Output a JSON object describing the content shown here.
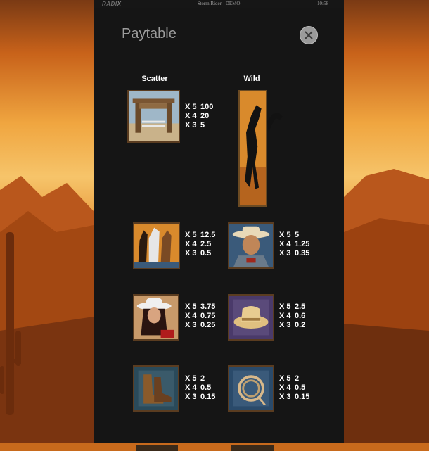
{
  "topbar": {
    "logo": "RADI",
    "title": "Storm Rider - DEMO",
    "time": "10:58"
  },
  "panel": {
    "title": "Paytable"
  },
  "headings": {
    "scatter": "Scatter",
    "wild": "Wild"
  },
  "symbols": [
    {
      "id": "scatter-gate",
      "icon": "ranch-gate-icon",
      "pays": [
        {
          "m": "X 5",
          "v": "100"
        },
        {
          "m": "X 4",
          "v": "20"
        },
        {
          "m": "X 3",
          "v": "5"
        }
      ]
    },
    {
      "id": "wild-horse",
      "icon": "black-stallion-icon",
      "pays": []
    },
    {
      "id": "horses",
      "icon": "horses-icon",
      "pays": [
        {
          "m": "X 5",
          "v": "12.5"
        },
        {
          "m": "X 4",
          "v": "2.5"
        },
        {
          "m": "X 3",
          "v": "0.5"
        }
      ]
    },
    {
      "id": "cowboy",
      "icon": "cowboy-icon",
      "pays": [
        {
          "m": "X 5",
          "v": "5"
        },
        {
          "m": "X 4",
          "v": "1.25"
        },
        {
          "m": "X 3",
          "v": "0.35"
        }
      ]
    },
    {
      "id": "cowgirl",
      "icon": "cowgirl-icon",
      "pays": [
        {
          "m": "X 5",
          "v": "3.75"
        },
        {
          "m": "X 4",
          "v": "0.75"
        },
        {
          "m": "X 3",
          "v": "0.25"
        }
      ]
    },
    {
      "id": "hat",
      "icon": "cowboy-hat-icon",
      "pays": [
        {
          "m": "X 5",
          "v": "2.5"
        },
        {
          "m": "X 4",
          "v": "0.6"
        },
        {
          "m": "X 3",
          "v": "0.2"
        }
      ]
    },
    {
      "id": "boots",
      "icon": "cowboy-boots-icon",
      "pays": [
        {
          "m": "X 5",
          "v": "2"
        },
        {
          "m": "X 4",
          "v": "0.5"
        },
        {
          "m": "X 3",
          "v": "0.15"
        }
      ]
    },
    {
      "id": "lasso",
      "icon": "lasso-icon",
      "pays": [
        {
          "m": "X 5",
          "v": "2"
        },
        {
          "m": "X 4",
          "v": "0.5"
        },
        {
          "m": "X 3",
          "v": "0.15"
        }
      ]
    }
  ],
  "colors": {
    "panel": "#151515",
    "frame": "#5a3c20",
    "text": "#ffffff",
    "title": "#9c9c9c"
  }
}
